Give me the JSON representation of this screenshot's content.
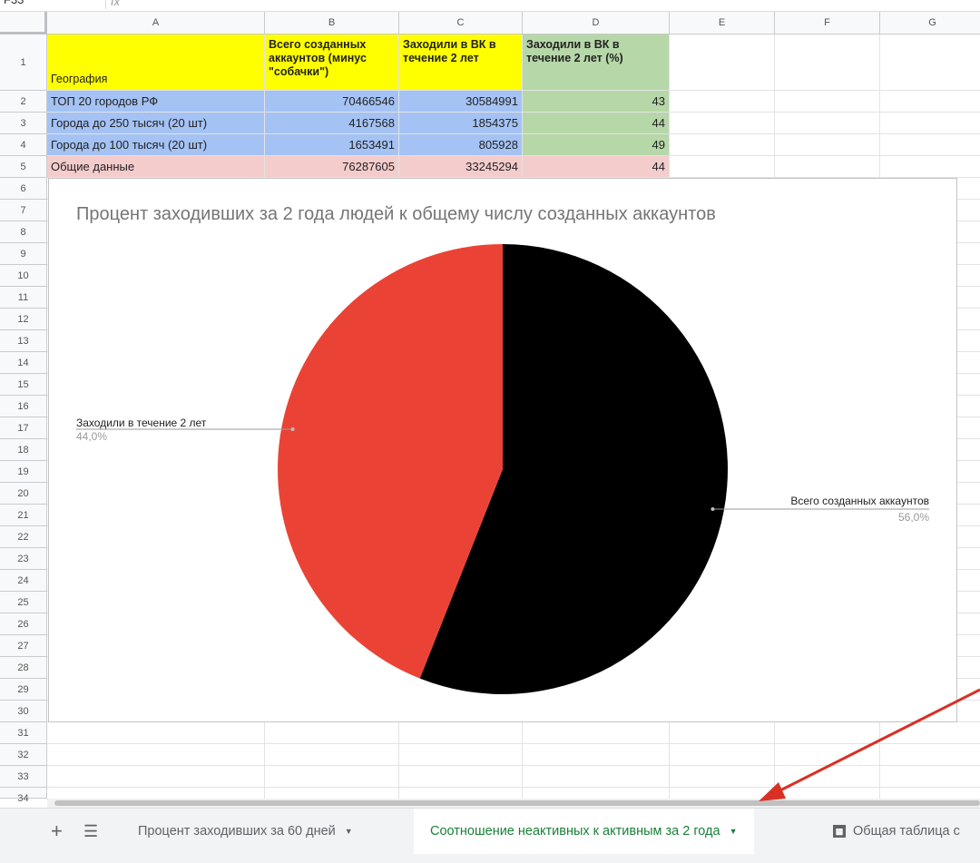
{
  "toolbar": {
    "namebox": "F33",
    "fx": "fx"
  },
  "columns": [
    "A",
    "B",
    "C",
    "D",
    "E",
    "F",
    "G"
  ],
  "rows": [
    "1",
    "2",
    "3",
    "4",
    "5",
    "6",
    "7",
    "8",
    "9",
    "10",
    "11",
    "12",
    "13",
    "14",
    "15",
    "16",
    "17",
    "18",
    "19",
    "20",
    "21",
    "22",
    "23",
    "24",
    "25",
    "26",
    "27",
    "28",
    "29",
    "30",
    "31",
    "32",
    "33",
    "34"
  ],
  "table": {
    "header": {
      "a": "География",
      "b": "Всего созданных аккаунтов (минус \"собачки\")",
      "c": "Заходили в ВК в течение 2 лет",
      "d": "Заходили в ВК в течение 2 лет (%)"
    },
    "data_rows": [
      {
        "a": "ТОП 20 городов РФ",
        "b": "70466546",
        "c": "30584991",
        "d": "43"
      },
      {
        "a": "Города до 250 тысяч (20 шт)",
        "b": "4167568",
        "c": "1854375",
        "d": "44"
      },
      {
        "a": "Города до 100 тысяч (20 шт)",
        "b": "1653491",
        "c": "805928",
        "d": "49"
      },
      {
        "a": "Общие данные",
        "b": "76287605",
        "c": "33245294",
        "d": "44"
      }
    ]
  },
  "colors": {
    "header_yellow": "#ffff00",
    "header_green": "#b6d7a8",
    "row_blue": "#a4c2f4",
    "row_green": "#b6d7a8",
    "row_pink": "#f4cccc",
    "slice_black": "#000000",
    "slice_red": "#ea4335",
    "tab_active": "#188038",
    "arrow_red": "#d93025"
  },
  "chart_data": {
    "type": "pie",
    "title": "Процент заходивших за 2 года людей к общему числу созданных аккаунтов",
    "slices": [
      {
        "name": "Всего созданных аккаунтов",
        "percent": 56.0,
        "label": "56,0%",
        "color": "#000000"
      },
      {
        "name": "Заходили в течение 2 лет",
        "percent": 44.0,
        "label": "44,0%",
        "color": "#ea4335"
      }
    ]
  },
  "sheet_tabs": {
    "add_icon": "plus-icon",
    "list_icon": "list-icon",
    "tabs": [
      {
        "label": "Процент заходивших за 60 дней"
      },
      {
        "label": "Соотношение неактивных к активным за 2 года"
      },
      {
        "label": "Общая таблица с"
      }
    ]
  }
}
